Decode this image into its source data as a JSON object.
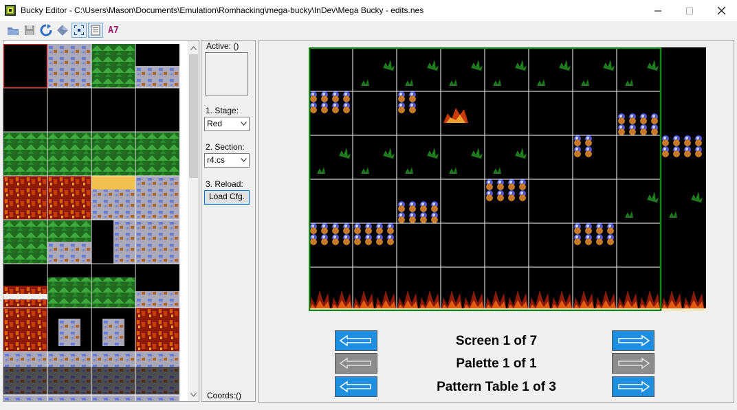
{
  "window": {
    "title": "Bucky Editor - C:\\Users\\Mason\\Documents\\Emulation\\Romhacking\\mega-bucky\\InDev\\Mega Bucky - edits.nes"
  },
  "toolbar": {
    "items": [
      "open-icon",
      "save-icon",
      "refresh-icon",
      "diamond-icon",
      "grid-icon",
      "page-icon"
    ],
    "hex_value": "A7"
  },
  "controls": {
    "active_label": "Active: ()",
    "stage_label": "1. Stage:",
    "stage_value": "Red",
    "section_label": "2. Section:",
    "section_value": "r4.cs",
    "reload_label": "3. Reload:",
    "load_button": "Load Cfg.",
    "coords_label": "Coords:()"
  },
  "viewer": {
    "screen_label": "Screen 1 of 7",
    "palette_label": "Palette 1 of 1",
    "pattern_label": "Pattern Table 1 of 3"
  },
  "colors": {
    "nav_active": "#1e8fe0",
    "nav_disabled": "#8c8c8c",
    "map_border": "#118811",
    "selection": "#d03030"
  }
}
